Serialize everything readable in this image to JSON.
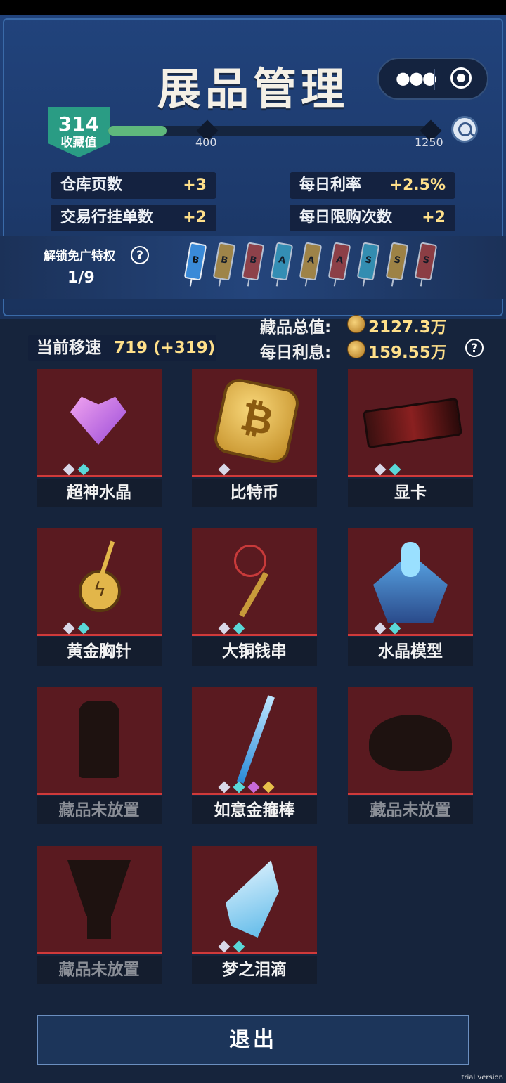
{
  "title": "展品管理",
  "collection": {
    "value": "314",
    "label": "收藏值",
    "milestones": [
      "400",
      "1250"
    ],
    "progress_value": 314
  },
  "stats": [
    {
      "key": "仓库页数",
      "value": "+3"
    },
    {
      "key": "每日利率",
      "value": "+2.5%"
    },
    {
      "key": "交易行挂单数",
      "value": "+2"
    },
    {
      "key": "每日限购次数",
      "value": "+2"
    }
  ],
  "unlock": {
    "label": "解锁免广特权",
    "help": "?",
    "count": "1/9",
    "tickets": [
      {
        "letter": "B",
        "color": "#3a8ad8"
      },
      {
        "letter": "B",
        "color": "#c89a3a"
      },
      {
        "letter": "B",
        "color": "#b0403a"
      },
      {
        "letter": "A",
        "color": "#3aa8c8"
      },
      {
        "letter": "A",
        "color": "#c89a3a"
      },
      {
        "letter": "A",
        "color": "#b0403a"
      },
      {
        "letter": "S",
        "color": "#3aa8c8"
      },
      {
        "letter": "S",
        "color": "#c89a3a"
      },
      {
        "letter": "S",
        "color": "#b0403a"
      }
    ]
  },
  "summary": {
    "total_label": "藏品总值:",
    "total_value": "2127.3万",
    "daily_label": "每日利息:",
    "daily_value": "159.55万",
    "help": "?"
  },
  "speed": {
    "label": "当前移速",
    "value": "719 (+319)"
  },
  "items": [
    {
      "name": "超神水晶",
      "stars": [
        "#d8d8e8",
        "#5ad8d8"
      ],
      "icon": "crystal-heart-icon",
      "empty": false
    },
    {
      "name": "比特币",
      "stars": [
        "#d8d8e8"
      ],
      "icon": "bitcoin-icon",
      "empty": false
    },
    {
      "name": "显卡",
      "stars": [
        "#d8d8e8",
        "#5ad8d8"
      ],
      "icon": "graphics-card-icon",
      "empty": false
    },
    {
      "name": "黄金胸针",
      "stars": [
        "#d8d8e8",
        "#5ad8d8"
      ],
      "icon": "golden-brooch-icon",
      "empty": false
    },
    {
      "name": "大铜钱串",
      "stars": [
        "#d8d8e8",
        "#5ad8d8"
      ],
      "icon": "coin-string-icon",
      "empty": false
    },
    {
      "name": "水晶模型",
      "stars": [
        "#d8d8e8",
        "#5ad8d8"
      ],
      "icon": "crystal-model-icon",
      "empty": false
    },
    {
      "name": "藏品未放置",
      "stars": [],
      "icon": "lantern-silhouette-icon",
      "empty": true
    },
    {
      "name": "如意金箍棒",
      "stars": [
        "#d8d8e8",
        "#5ad8d8",
        "#c86ad8",
        "#e8c04a"
      ],
      "icon": "golden-staff-icon",
      "empty": false
    },
    {
      "name": "藏品未放置",
      "stars": [],
      "icon": "beast-silhouette-icon",
      "empty": true
    },
    {
      "name": "藏品未放置",
      "stars": [],
      "icon": "trophy-silhouette-icon",
      "empty": true
    },
    {
      "name": "梦之泪滴",
      "stars": [
        "#d8d8e8",
        "#5ad8d8"
      ],
      "icon": "dream-teardrop-icon",
      "empty": false
    }
  ],
  "exit_label": "退出",
  "watermark": "trial version"
}
